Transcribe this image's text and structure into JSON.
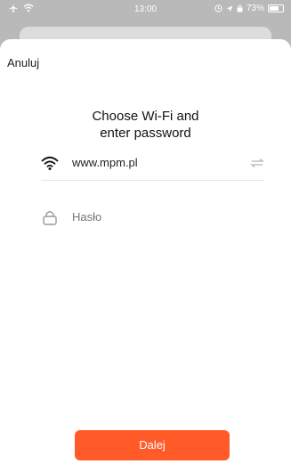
{
  "status": {
    "time": "13:00",
    "battery": "73%",
    "battery_level": 0.73
  },
  "header": {
    "cancel_label": "Anuluj"
  },
  "main": {
    "title_line1": "Choose Wi-Fi and",
    "title_line2": "enter password",
    "wifi_name": "www.mpm.pl",
    "password_placeholder": "Hasło"
  },
  "footer": {
    "next_label": "Dalej"
  },
  "colors": {
    "accent": "#ff5a28",
    "backdrop": "#b9b9b9"
  },
  "icons": [
    "airplane-icon",
    "wifi-icon",
    "alarm-icon",
    "location-icon",
    "lock-icon",
    "switch-network-icon"
  ]
}
